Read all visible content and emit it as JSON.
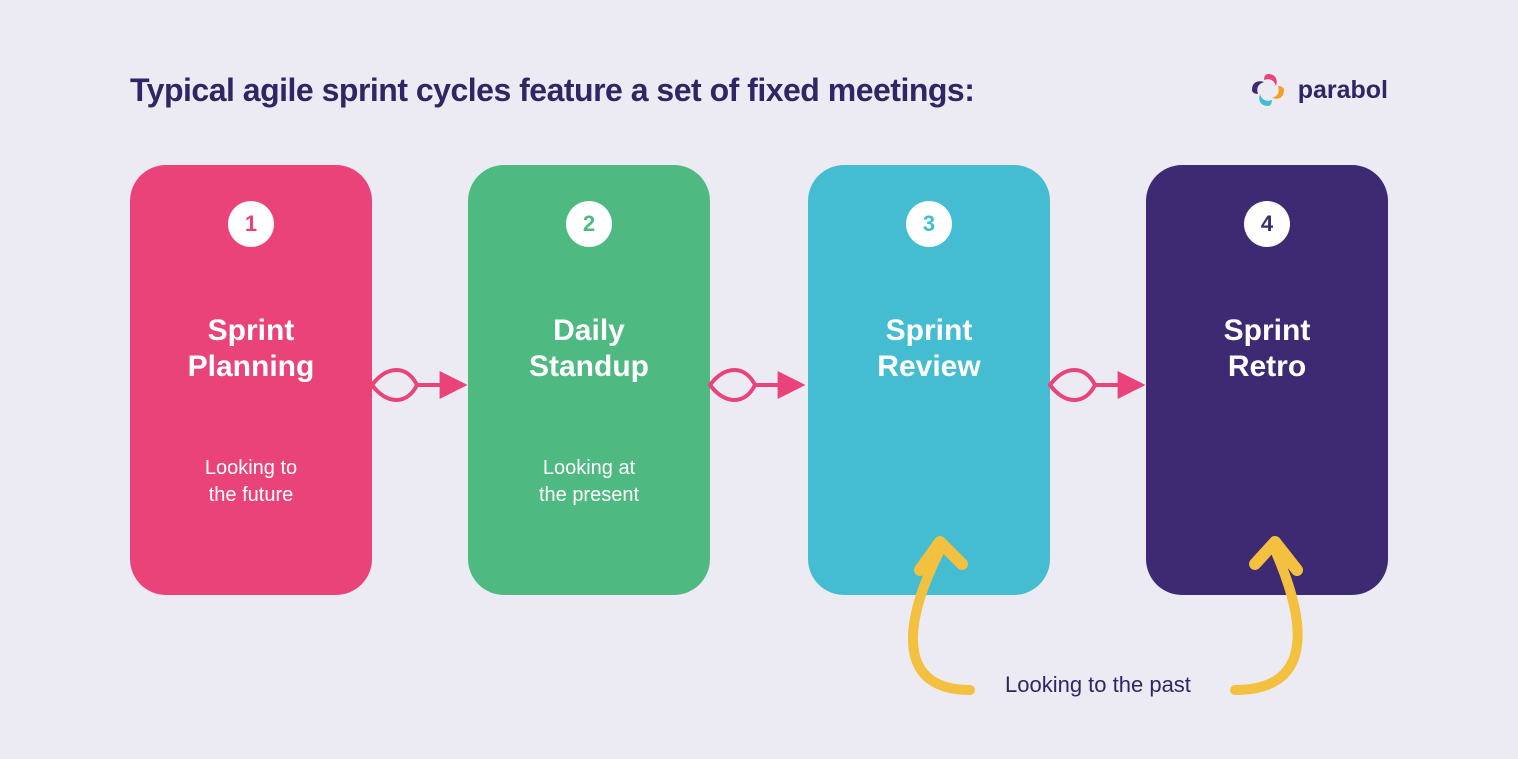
{
  "title": "Typical agile sprint cycles feature a set of fixed meetings:",
  "brand": {
    "name": "parabol"
  },
  "colors": {
    "bg": "#ECEBF4",
    "heading": "#2F2663",
    "connector": "#E9437A",
    "curved": "#F4C03F",
    "cards": [
      "#E9437A",
      "#4EB980",
      "#44BDD3",
      "#3E2A72"
    ]
  },
  "cards": [
    {
      "num": "1",
      "title": "Sprint\nPlanning",
      "sub": "Looking to\nthe future"
    },
    {
      "num": "2",
      "title": "Daily\nStandup",
      "sub": "Looking at\nthe present"
    },
    {
      "num": "3",
      "title": "Sprint\nReview",
      "sub": ""
    },
    {
      "num": "4",
      "title": "Sprint\nRetro",
      "sub": ""
    }
  ],
  "caption": "Looking to the past"
}
